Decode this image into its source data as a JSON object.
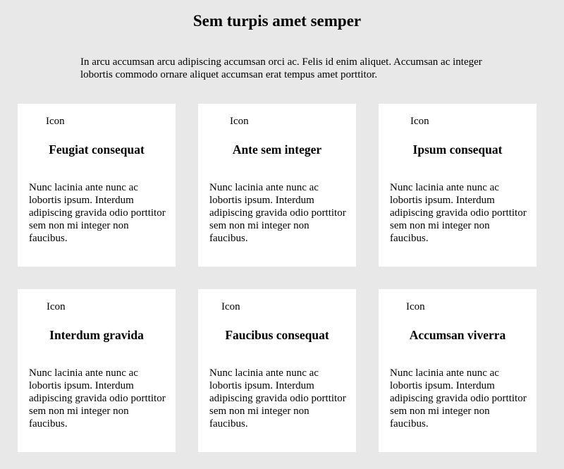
{
  "header": {
    "title": "Sem turpis amet semper",
    "intro": "In arcu accumsan arcu adipiscing accumsan orci ac. Felis id enim aliquet. Accumsan ac integer lobortis commodo ornare aliquet accumsan erat tempus amet porttitor."
  },
  "cards": [
    {
      "icon": "Icon",
      "title": "Feugiat consequat",
      "body": "Nunc lacinia ante nunc ac lobortis ipsum. Interdum adipiscing gravida odio porttitor sem non mi integer non faucibus."
    },
    {
      "icon": "Icon",
      "title": "Ante sem integer",
      "body": "Nunc lacinia ante nunc ac lobortis ipsum. Interdum adipiscing gravida odio porttitor sem non mi integer non faucibus."
    },
    {
      "icon": "Icon",
      "title": "Ipsum consequat",
      "body": "Nunc lacinia ante nunc ac lobortis ipsum. Interdum adipiscing gravida odio porttitor sem non mi integer non faucibus."
    },
    {
      "icon": "Icon",
      "title": "Interdum gravida",
      "body": "Nunc lacinia ante nunc ac lobortis ipsum. Interdum adipiscing gravida odio porttitor sem non mi integer non faucibus."
    },
    {
      "icon": "Icon",
      "title": "Faucibus consequat",
      "body": "Nunc lacinia ante nunc ac lobortis ipsum. Interdum adipiscing gravida odio porttitor sem non mi integer non faucibus."
    },
    {
      "icon": "Icon",
      "title": "Accumsan viverra",
      "body": "Nunc lacinia ante nunc ac lobortis ipsum. Interdum adipiscing gravida odio porttitor sem non mi integer non faucibus."
    }
  ]
}
